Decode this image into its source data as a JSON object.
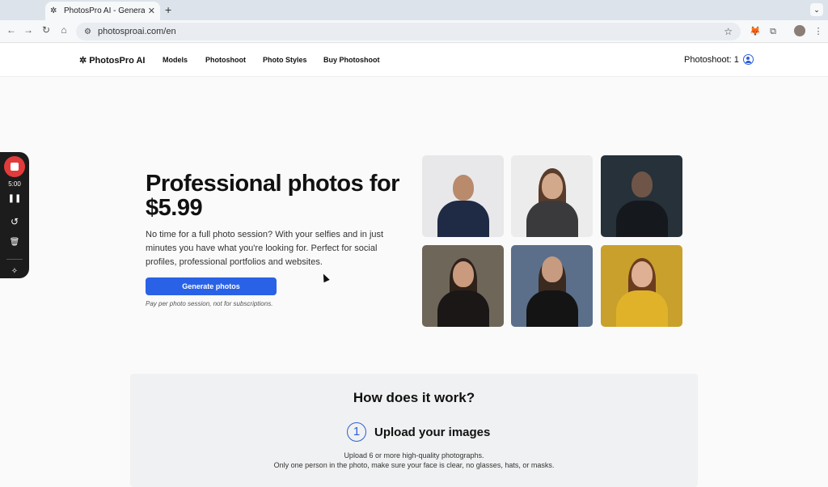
{
  "browser": {
    "tab_title": "PhotosPro AI - Generate profi",
    "url": "photosproai.com/en"
  },
  "header": {
    "brand": "PhotosPro AI",
    "nav": [
      "Models",
      "Photoshoot",
      "Photo Styles",
      "Buy Photoshoot"
    ],
    "photoshoot_count": "Photoshoot: 1"
  },
  "hero": {
    "title": "Professional photos for $5.99",
    "text": "No time for a full photo session? With your selfies and in just minutes you have what you're looking for. Perfect for social profiles, professional portfolios and websites.",
    "button": "Generate photos",
    "note": "Pay per photo session, not for subscriptions."
  },
  "how": {
    "title": "How does it work?",
    "step_number": "1",
    "step_title": "Upload your images",
    "step_desc_1": "Upload 6 or more high-quality photographs.",
    "step_desc_2": "Only one person in the photo, make sure your face is clear, no glasses, hats, or masks."
  },
  "recorder": {
    "time": "5:00"
  },
  "colors": {
    "accent": "#2962e6",
    "record": "#e23b3b"
  }
}
